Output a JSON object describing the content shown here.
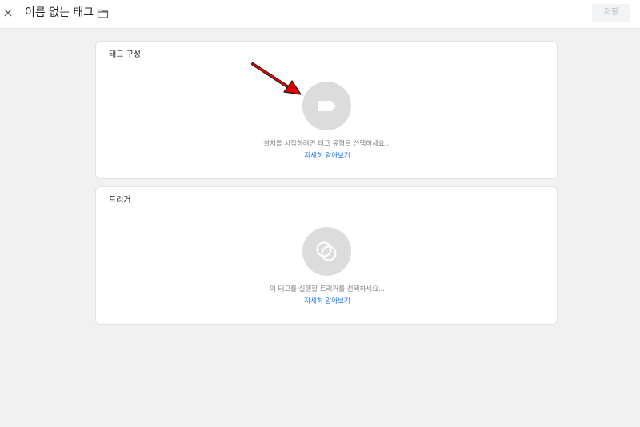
{
  "header": {
    "title": "이름 없는 태그",
    "save_label": "저장"
  },
  "tag_config": {
    "title": "태그 구성",
    "hint": "설치를 시작하려면 태그 유형을 선택하세요...",
    "learn_more": "자세히 알아보기"
  },
  "triggers": {
    "title": "트리거",
    "hint": "이 태그를 실행할 트리거를 선택하세요...",
    "learn_more": "자세히 알아보기"
  },
  "icons": {
    "close": "close-icon",
    "folder": "folder-icon",
    "tag": "tag-icon",
    "trigger": "trigger-icon",
    "annotation": "red-arrow-icon"
  },
  "colors": {
    "accent": "#1a73e8",
    "circle": "#dcdcdc",
    "arrow": "#e00000"
  }
}
